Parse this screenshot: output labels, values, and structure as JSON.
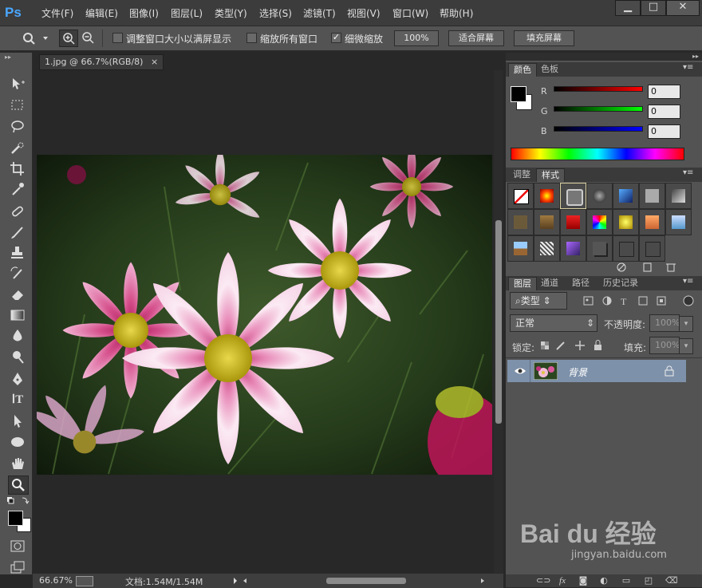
{
  "app": {
    "logo": "Ps"
  },
  "menu": [
    "文件(F)",
    "编辑(E)",
    "图像(I)",
    "图层(L)",
    "类型(Y)",
    "选择(S)",
    "滤镜(T)",
    "视图(V)",
    "窗口(W)",
    "帮助(H)"
  ],
  "window_buttons": {
    "minimize": "▁",
    "maximize": "□",
    "close": "✕"
  },
  "options": {
    "resize_windows": "调整窗口大小以满屏显示",
    "zoom_all": "缩放所有窗口",
    "scrubby_zoom": "细微缩放",
    "zoom_100": "100%",
    "fit_screen": "适合屏幕",
    "fill_screen": "填充屏幕"
  },
  "document": {
    "tab_title": "1.jpg @ 66.7%(RGB/8)",
    "close": "×"
  },
  "status": {
    "zoom": "66.67%",
    "doc_size": "文档:1.54M/1.54M"
  },
  "color_panel": {
    "tabs": [
      "颜色",
      "色板"
    ],
    "channels": [
      {
        "label": "R",
        "value": "0"
      },
      {
        "label": "G",
        "value": "0"
      },
      {
        "label": "B",
        "value": "0"
      }
    ]
  },
  "styles_panel": {
    "tabs": [
      "调整",
      "样式"
    ]
  },
  "layers_panel": {
    "tabs": [
      "图层",
      "通道",
      "路径",
      "历史记录"
    ],
    "filter_kind": "类型",
    "blend_mode": "正常",
    "opacity_label": "不透明度:",
    "opacity_value": "100%",
    "lock_label": "锁定:",
    "fill_label": "填充:",
    "fill_value": "100%",
    "layers": [
      {
        "name": "背景"
      }
    ]
  },
  "watermark": {
    "brand": "Bai du 经验",
    "url": "jingyan.baidu.com"
  }
}
